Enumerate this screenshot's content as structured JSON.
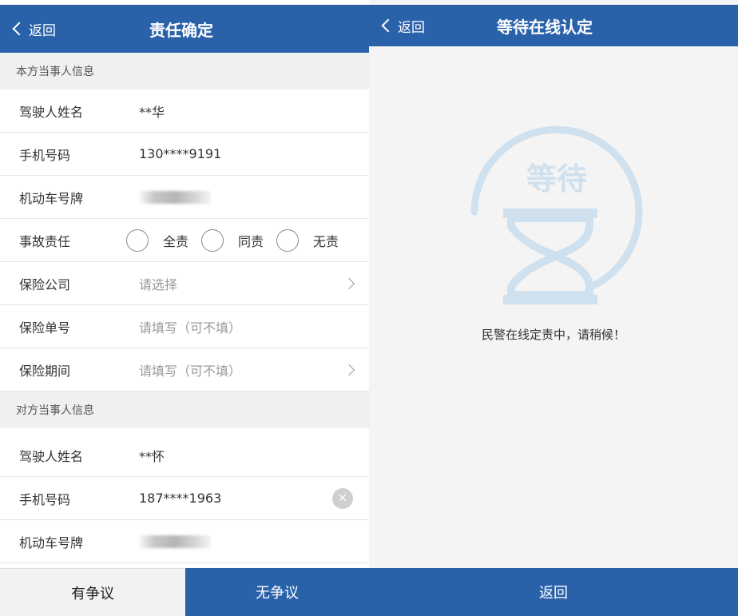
{
  "left": {
    "header": {
      "back_label": "返回",
      "title": "责任确定"
    },
    "self_section_title": "本方当事人信息",
    "self": {
      "driver_label": "驾驶人姓名",
      "driver_value": "**华",
      "phone_label": "手机号码",
      "phone_value": "130****9191",
      "plate_label": "机动车号牌",
      "liability_label": "事故责任",
      "liability_options": [
        "全责",
        "同责",
        "无责"
      ],
      "insurer_label": "保险公司",
      "insurer_placeholder": "请选择",
      "policy_label": "保险单号",
      "policy_placeholder": "请填写（可不填）",
      "period_label": "保险期间",
      "period_placeholder": "请填写（可不填）"
    },
    "other_section_title": "对方当事人信息",
    "other": {
      "driver_label": "驾驶人姓名",
      "driver_value": "**怀",
      "phone_label": "手机号码",
      "phone_value": "187****1963",
      "plate_label": "机动车号牌"
    },
    "footer": {
      "dispute_label": "有争议",
      "no_dispute_label": "无争议"
    }
  },
  "right": {
    "header": {
      "back_label": "返回",
      "title": "等待在线认定"
    },
    "badge_text": "等待",
    "wait_message": "民警在线定责中，请稍候！",
    "footer": {
      "return_label": "返回"
    }
  },
  "colors": {
    "brand_blue": "#2a62aa",
    "badge_blue": "#cfe0ee"
  },
  "icons": [
    "back-chevron-icon",
    "chevron-right-icon",
    "clear-icon",
    "hourglass-icon",
    "radio-circle-icon"
  ]
}
